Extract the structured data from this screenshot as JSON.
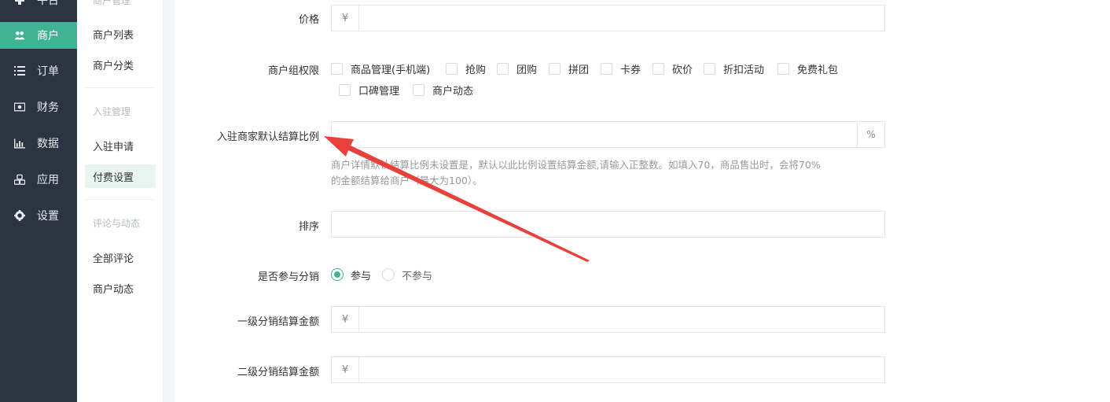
{
  "nav": {
    "top_partial_label": "平台",
    "items": [
      {
        "label": "商户",
        "icon": "users-icon"
      },
      {
        "label": "订单",
        "icon": "list-icon"
      },
      {
        "label": "财务",
        "icon": "money-icon"
      },
      {
        "label": "数据",
        "icon": "bar-chart-icon"
      },
      {
        "label": "应用",
        "icon": "cubes-icon"
      },
      {
        "label": "设置",
        "icon": "gear-icon"
      }
    ],
    "active_color": "#3fb393"
  },
  "subnav": {
    "top_partial_group": "商户管理",
    "merchant_items": [
      "商户列表",
      "商户分类"
    ],
    "settle_group": "入驻管理",
    "settle_items": [
      "入驻申请",
      "付费设置"
    ],
    "review_group": "评论与动态",
    "review_items": [
      "全部评论",
      "商户动态"
    ]
  },
  "form": {
    "price": {
      "label": "价格",
      "prefix": "¥",
      "value": ""
    },
    "permissions": {
      "label": "商户组权限",
      "options": [
        "商品管理(手机端)",
        "抢购",
        "团购",
        "拼团",
        "卡券",
        "砍价",
        "折扣活动",
        "免费礼包",
        "口碑管理",
        "商户动态"
      ]
    },
    "ratio": {
      "label": "入驻商家默认结算比例",
      "suffix": "%",
      "value": "",
      "help_line1": "商户详情默认结算比例未设置是，默认以此比例设置结算金额,请输入正整数。如填入70，商品售出时，会将70%",
      "help_line2": "的金额结算给商户（最大为100）。"
    },
    "sort": {
      "label": "排序",
      "value": ""
    },
    "distribution": {
      "label": "是否参与分销",
      "options": [
        "参与",
        "不参与"
      ],
      "selected": "参与"
    },
    "level1": {
      "label": "一级分销结算金额",
      "prefix": "¥",
      "value": ""
    },
    "level2": {
      "label": "二级分销结算金额",
      "prefix": "¥",
      "value": ""
    }
  },
  "annotation": {
    "arrow_color": "#e8403a"
  }
}
